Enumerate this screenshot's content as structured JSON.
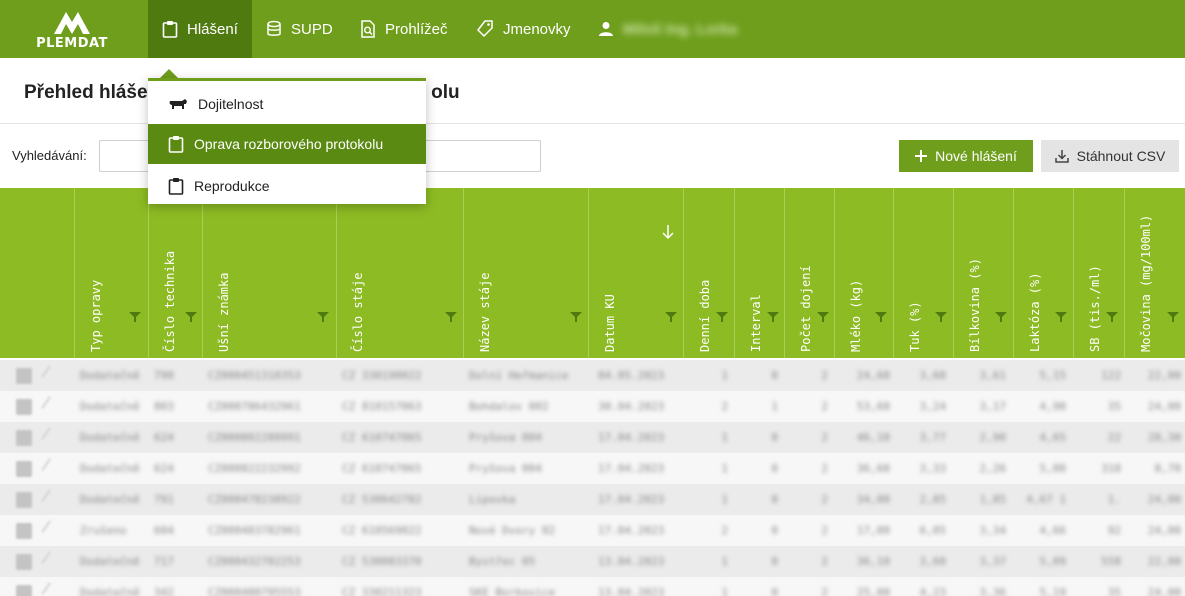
{
  "brand": {
    "logo_text": "PLEMDAT"
  },
  "nav": {
    "items": [
      {
        "label": "Hlášení",
        "icon": "clipboard-icon",
        "active": true
      },
      {
        "label": "SUPD",
        "icon": "database-icon"
      },
      {
        "label": "Prohlížeč",
        "icon": "document-search-icon"
      },
      {
        "label": "Jmenovky",
        "icon": "tag-icon"
      }
    ],
    "user_name": "Miloš Ing. Lorka"
  },
  "dropdown": {
    "items": [
      {
        "label": "Dojitelnost",
        "icon": "cow-icon"
      },
      {
        "label": "Oprava rozborového protokolu",
        "icon": "clipboard-icon",
        "selected": true
      },
      {
        "label": "Reprodukce",
        "icon": "clipboard-icon"
      }
    ]
  },
  "page": {
    "title": "Přehled hlášení – oprava rozborového protokolu",
    "title_visible_start": "Přehled hlášen",
    "title_visible_end": "olu"
  },
  "toolbar": {
    "search_label": "Vyhledávání:",
    "search_value": "",
    "new_button": "Nové hlášení",
    "csv_button": "Stáhnout CSV"
  },
  "colors": {
    "primary": "#6e9e1c",
    "primary_dark": "#4f7a10",
    "header_row": "#8dbb23"
  },
  "table": {
    "columns": [
      {
        "label": "Typ opravy"
      },
      {
        "label": "Číslo technika"
      },
      {
        "label": "Ušní známka"
      },
      {
        "label": "Číslo stáje"
      },
      {
        "label": "Název stáje"
      },
      {
        "label": "Datum KU",
        "sorted": "desc"
      },
      {
        "label": "Denní doba"
      },
      {
        "label": "Interval"
      },
      {
        "label": "Počet dojení"
      },
      {
        "label": "Mléko (kg)"
      },
      {
        "label": "Tuk (%)"
      },
      {
        "label": "Bílkovina (%)"
      },
      {
        "label": "Laktóza (%)"
      },
      {
        "label": "SB (tis./ml)"
      },
      {
        "label": "Močovina (mg/100ml)"
      }
    ],
    "rows": [
      [
        "Dodatečně",
        "790",
        "CZ000451310353",
        "CZ 330190022",
        "Dolní Heřmanice",
        "04.05.2023",
        "1",
        "0",
        "2",
        "24,60",
        "3,60",
        "3,61",
        "5,15",
        "122",
        "22,00"
      ],
      [
        "Dodatečně",
        "803",
        "CZ000786432961",
        "CZ 810157063",
        "Bohdalov 002",
        "30.04.2023",
        "2",
        "1",
        "2",
        "53,60",
        "3,24",
        "3,17",
        "4,90",
        "35",
        "24,00"
      ],
      [
        "Dodatečně",
        "624",
        "CZ000802280991",
        "CZ 610747065",
        "Pryšova 004",
        "17.04.2023",
        "1",
        "0",
        "2",
        "46,10",
        "3,77",
        "2,90",
        "4,65",
        "22",
        "28,30"
      ],
      [
        "Dodatečně",
        "624",
        "CZ000822232992",
        "CZ 610747065",
        "Pryšova 004",
        "17.04.2023",
        "1",
        "0",
        "2",
        "36,60",
        "3,33",
        "2,26",
        "5,00",
        "318",
        "8,70"
      ],
      [
        "Dodatečně",
        "791",
        "CZ000478238922",
        "CZ 530642782",
        "Lipovka",
        "17.04.2023",
        "1",
        "0",
        "2",
        "34,00",
        "2,85",
        "1,85",
        "4,67 1",
        "1.",
        "24,00"
      ],
      [
        "Zrušeno",
        "604",
        "CZ000483782961",
        "CZ 610569022",
        "Nové Dvory 02",
        "17.04.2023",
        "2",
        "0",
        "2",
        "17,00",
        "6,05",
        "3,34",
        "4,66",
        "92",
        "24,00"
      ],
      [
        "Dodatečně",
        "717",
        "CZ000432702253",
        "CZ 530083370",
        "Bystřec 05",
        "13.04.2023",
        "1",
        "0",
        "2",
        "36,10",
        "3,60",
        "3,37",
        "5,09",
        "558",
        "22,00"
      ],
      [
        "Dodatečně",
        "342",
        "CZ000480795553",
        "CZ 330211323",
        "SKE Borkovice",
        "13.04.2023",
        "1",
        "0",
        "2",
        "25,00",
        "4,23",
        "3,36",
        "5,19",
        "35",
        "24,00"
      ]
    ]
  }
}
